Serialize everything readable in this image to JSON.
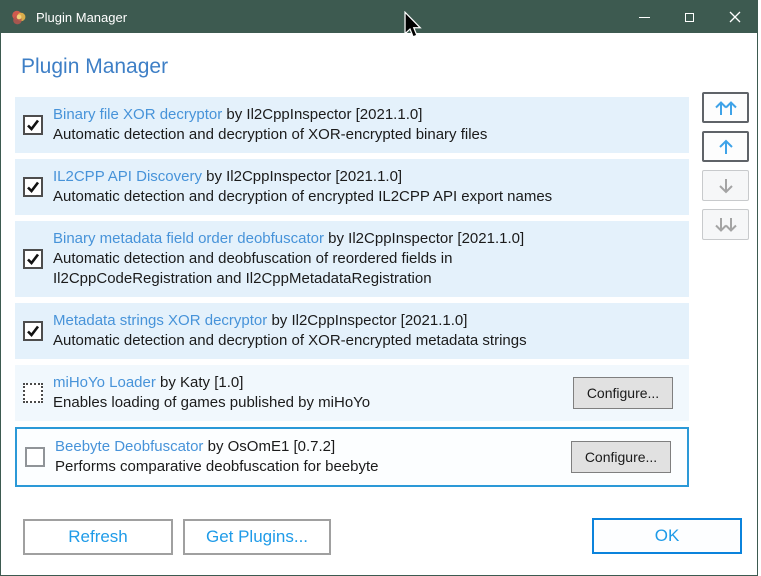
{
  "window": {
    "title": "Plugin Manager",
    "controls": [
      {
        "name": "minimize"
      },
      {
        "name": "maximize"
      },
      {
        "name": "close"
      }
    ]
  },
  "header": {
    "title": "Plugin Manager"
  },
  "labels": {
    "configure": "Configure...",
    "refresh": "Refresh",
    "get_plugins": "Get Plugins...",
    "ok": "OK"
  },
  "plugins": [
    {
      "name": "Binary file XOR decryptor",
      "byline": "by Il2CppInspector [2021.1.0]",
      "description_lines": [
        "Automatic detection and decryption of XOR-encrypted binary files"
      ],
      "state": "checked",
      "has_configure": false,
      "selected": false
    },
    {
      "name": "IL2CPP API Discovery",
      "byline": "by Il2CppInspector [2021.1.0]",
      "description_lines": [
        "Automatic detection and decryption of encrypted IL2CPP API export names"
      ],
      "state": "checked",
      "has_configure": false,
      "selected": false
    },
    {
      "name": "Binary metadata field order deobfuscator",
      "byline": "by Il2CppInspector [2021.1.0]",
      "description_lines": [
        "Automatic detection and deobfuscation of reordered fields in",
        "Il2CppCodeRegistration and Il2CppMetadataRegistration"
      ],
      "state": "checked",
      "has_configure": false,
      "selected": false
    },
    {
      "name": "Metadata strings XOR decryptor",
      "byline": "by Il2CppInspector [2021.1.0]",
      "description_lines": [
        "Automatic detection and decryption of XOR-encrypted metadata strings"
      ],
      "state": "checked",
      "has_configure": false,
      "selected": false
    },
    {
      "name": "miHoYo Loader",
      "byline": "by Katy [1.0]",
      "description_lines": [
        "Enables loading of games published by miHoYo"
      ],
      "state": "indeterminate",
      "has_configure": true,
      "selected": false
    },
    {
      "name": "Beebyte Deobfuscator",
      "byline": "by OsOmE1 [0.7.2]",
      "description_lines": [
        "Performs comparative deobfuscation for beebyte"
      ],
      "state": "unchecked",
      "has_configure": true,
      "selected": true
    }
  ],
  "reorder_buttons": [
    {
      "name": "move-to-top",
      "enabled": true
    },
    {
      "name": "move-up",
      "enabled": true
    },
    {
      "name": "move-down",
      "enabled": false
    },
    {
      "name": "move-to-bottom",
      "enabled": false
    }
  ],
  "colors": {
    "titlebar": "#3d5a50",
    "heading": "#3e7fc6",
    "link": "#4793d9",
    "row_checked_bg": "#e4f1fb",
    "row_light_bg": "#f1f8fd",
    "selection_border": "#2b99d7",
    "button_text": "#1f9be8",
    "ok_border": "#0b83dc"
  }
}
